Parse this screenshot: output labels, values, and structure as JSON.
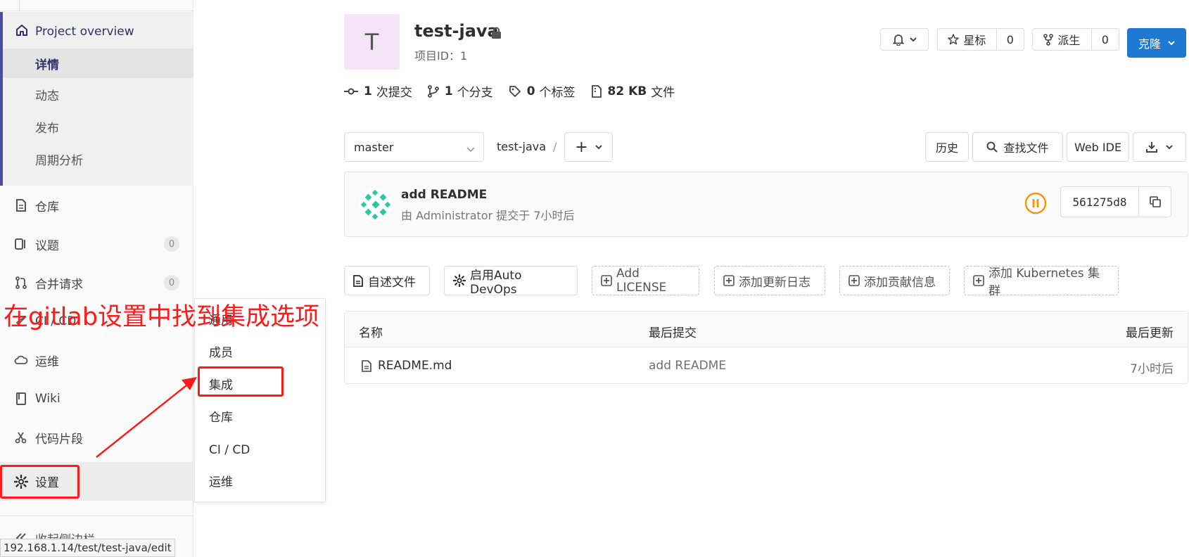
{
  "sidebar": {
    "project_overview": "Project overview",
    "overview_items": [
      {
        "label": "详情"
      },
      {
        "label": "动态"
      },
      {
        "label": "发布"
      },
      {
        "label": "周期分析"
      }
    ],
    "main_items": [
      {
        "label": "仓库",
        "icon": "file-icon"
      },
      {
        "label": "议题",
        "icon": "issues-icon",
        "count": "0"
      },
      {
        "label": "合并请求",
        "icon": "merge-request-icon",
        "count": "0"
      },
      {
        "label": "CI / CD",
        "icon": "rocket-icon"
      },
      {
        "label": "运维",
        "icon": "cloud-gear-icon"
      },
      {
        "label": "Wiki",
        "icon": "book-icon"
      },
      {
        "label": "代码片段",
        "icon": "scissors-icon"
      },
      {
        "label": "设置",
        "icon": "gear-icon"
      }
    ],
    "collapse_label": "收起侧边栏"
  },
  "settings_flyout": {
    "items": [
      "通用",
      "成员",
      "集成",
      "仓库",
      "CI / CD",
      "运维"
    ]
  },
  "status_url": "192.168.1.14/test/test-java/edit",
  "project": {
    "avatar_letter": "T",
    "name": "test-java",
    "id_text": "项目ID：1"
  },
  "header_buttons": {
    "star_label": "星标",
    "star_count": "0",
    "fork_label": "派生",
    "fork_count": "0",
    "clone_label": "克隆"
  },
  "stats": [
    {
      "value": "1",
      "label": "次提交",
      "icon": "commit-icon"
    },
    {
      "value": "1",
      "label": "个分支",
      "icon": "branch-icon"
    },
    {
      "value": "0",
      "label": "个标签",
      "icon": "tag-icon"
    },
    {
      "value": "82 KB",
      "label": "文件",
      "icon": "file-zip-icon"
    }
  ],
  "repo_nav": {
    "branch": "master",
    "path_root": "test-java",
    "path_sep": "/",
    "add_symbol": "+",
    "history_label": "历史",
    "find_file_label": "查找文件",
    "web_ide_label": "Web IDE"
  },
  "last_commit": {
    "title": "add README",
    "meta": "由 Administrator 提交于 7小时后",
    "sha": "561275d8"
  },
  "actions": [
    {
      "label": "自述文件",
      "icon": "file-icon",
      "style": "solid"
    },
    {
      "label": "启用Auto DevOps",
      "icon": "gear-icon",
      "style": "solid"
    },
    {
      "label": "Add LICENSE",
      "icon": "plus-square-icon",
      "style": "dashed"
    },
    {
      "label": "添加更新日志",
      "icon": "plus-square-icon",
      "style": "dashed"
    },
    {
      "label": "添加贡献信息",
      "icon": "plus-square-icon",
      "style": "dashed"
    },
    {
      "label": "添加 Kubernetes 集群",
      "icon": "plus-square-icon",
      "style": "dashed"
    }
  ],
  "file_table": {
    "headers": [
      "名称",
      "最后提交",
      "最后更新"
    ],
    "rows": [
      {
        "name": "README.md",
        "commit": "add README",
        "updated": "7小时后"
      }
    ]
  },
  "annotation": {
    "text": "在gitlab设置中找到集成选项",
    "color": "#ff1a1a"
  },
  "colors": {
    "accent": "#1f78d1",
    "sidebar_active": "#4b4ba3",
    "pipeline_paused": "#fc9403",
    "avatar_bg": "#f3e5f5"
  }
}
